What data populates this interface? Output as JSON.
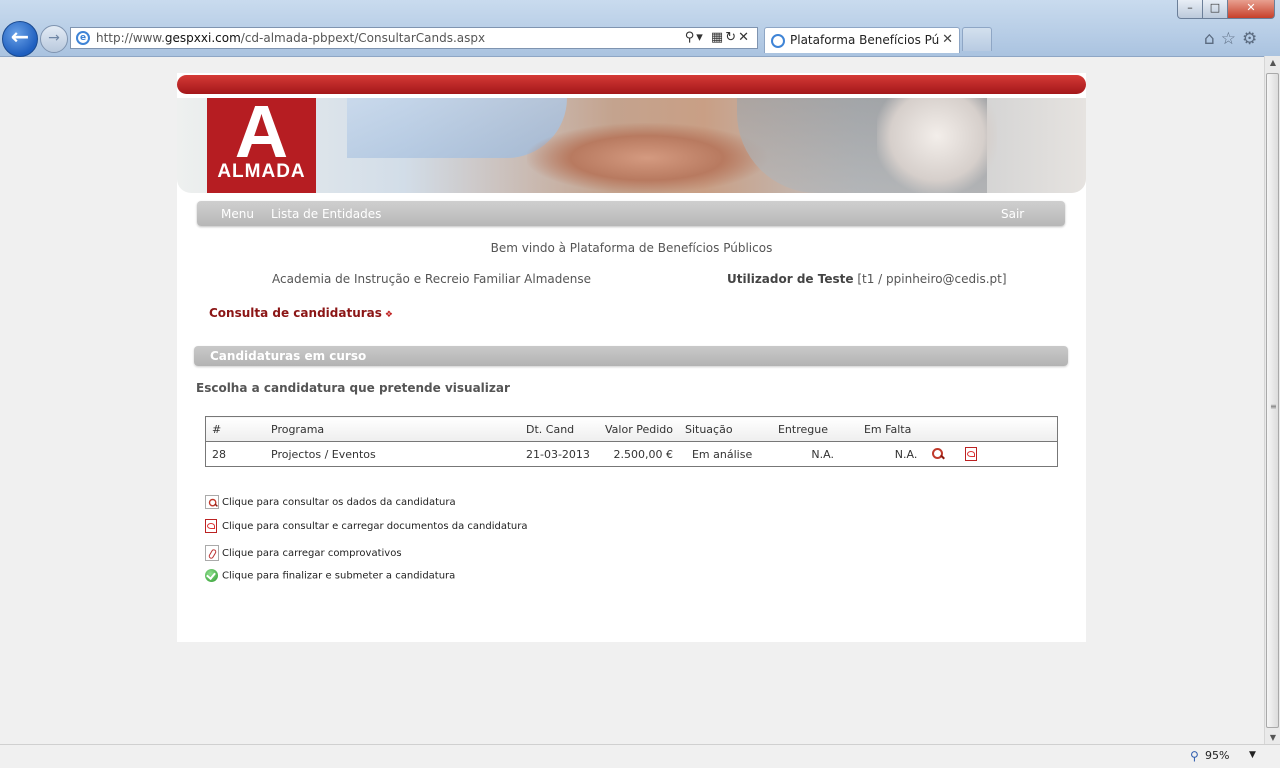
{
  "browser": {
    "address_url_prefix": "http://www.",
    "address_url_domain": "gespxxi.com",
    "address_url_path": "/cd-almada-pbpext/ConsultarCands.aspx",
    "tab_title": "Plataforma Benefícios Públi...",
    "zoom": "95%"
  },
  "banner": {
    "logo_letter": "A",
    "logo_text": "ALMADA"
  },
  "menu": {
    "items": [
      {
        "label": "Menu"
      },
      {
        "label": "Lista de Entidades"
      }
    ],
    "logout_label": "Sair"
  },
  "welcome": "Bem vindo à Plataforma de Benefícios Públicos",
  "entity_name": "Academia de Instrução e Recreio Familiar Almadense",
  "user": {
    "name": "Utilizador de Teste",
    "details": "[t1 / ppinheiro@cedis.pt]"
  },
  "page_title": "Consulta de candidaturas",
  "section_title": "Candidaturas em curso",
  "instruction": "Escolha a candidatura que pretende visualizar",
  "table": {
    "headers": [
      "#",
      "Programa",
      "Dt. Cand",
      "Valor Pedido",
      "Situação",
      "Entregue",
      "Em Falta"
    ],
    "rows": [
      {
        "id": "28",
        "programa": "Projectos / Eventos",
        "dt_cand": "21-03-2013",
        "valor": "2.500,00 €",
        "situacao": "Em análise",
        "entregue": "N.A.",
        "em_falta": "N.A."
      }
    ]
  },
  "legend": [
    {
      "icon": "magnifier-icon",
      "text": "Clique para consultar os dados da candidatura"
    },
    {
      "icon": "pdf-icon",
      "text": "Clique para consultar e carregar documentos da candidatura"
    },
    {
      "icon": "paperclip-icon",
      "text": "Clique para carregar comprovativos"
    },
    {
      "icon": "check-icon",
      "text": "Clique para finalizar e submeter a candidatura"
    }
  ],
  "colors": {
    "brand_red": "#b61d22",
    "title_red": "#8b1515",
    "menu_gray": "#c0c0c0"
  }
}
